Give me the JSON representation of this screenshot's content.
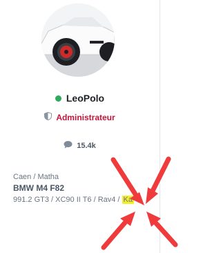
{
  "profile": {
    "username": "LeoPolo",
    "online_color": "#2eaa5c",
    "role": "Administrateur",
    "role_color": "#c2143c",
    "stats": {
      "messages": "15.4k"
    },
    "location": "Caen / Matha",
    "main_car": "BMW M4 F82",
    "cars_prefix": "991.2 GT3 / XC90 II T6 / Rav4 / ",
    "cars_highlighted": "Ka",
    "highlight_color": "#f5ef2a"
  },
  "annotation": {
    "arrow_color": "#ef3b3b"
  },
  "icons": [
    "shield-icon",
    "comment-icon"
  ]
}
